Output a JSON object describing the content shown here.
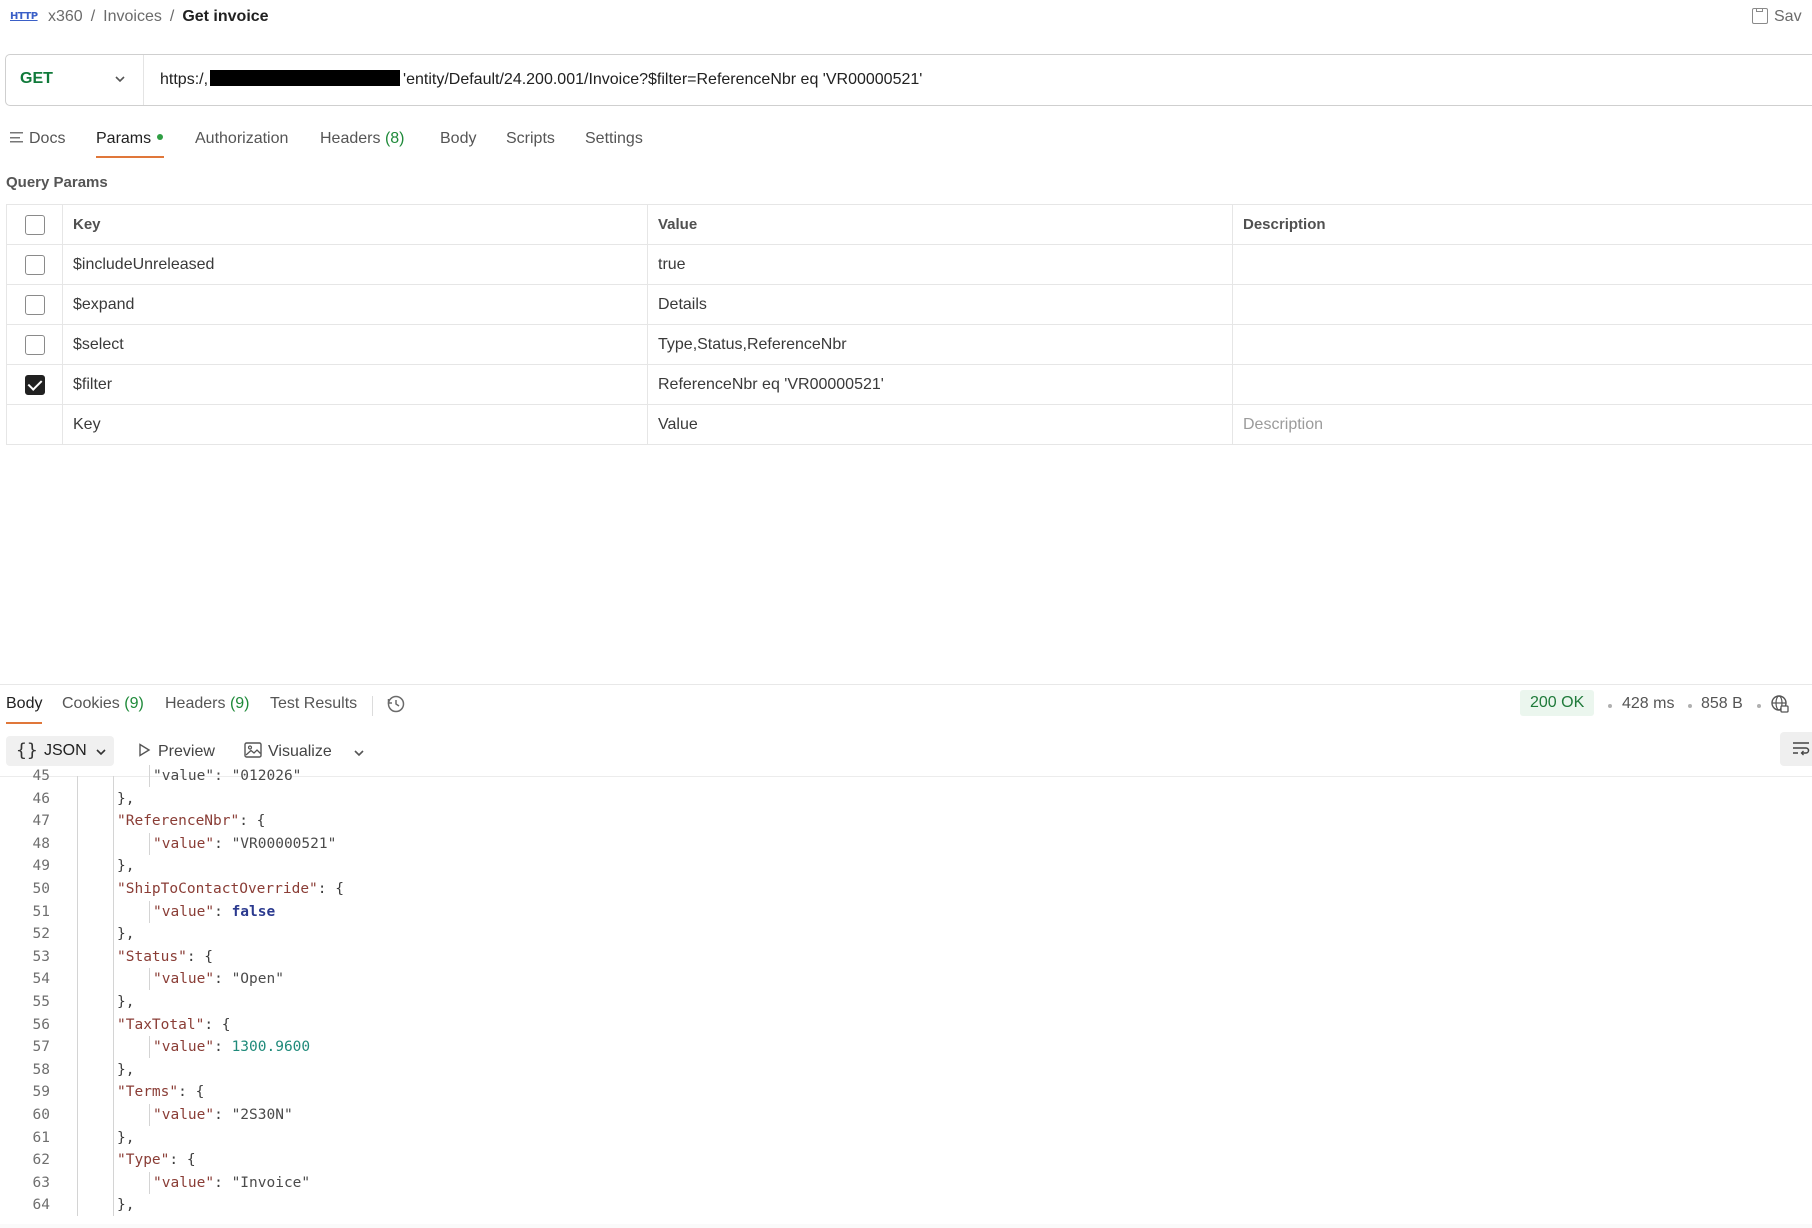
{
  "breadcrumb": {
    "icon_text": "HTTP",
    "items": [
      "x360",
      "Invoices"
    ],
    "current": "Get invoice"
  },
  "save_label": "Sav",
  "request": {
    "method": "GET",
    "url_prefix": "https:/,",
    "url_suffix": "'entity/Default/24.200.001/Invoice?$filter=ReferenceNbr eq 'VR00000521'"
  },
  "request_tabs": {
    "docs": "Docs",
    "params": "Params",
    "authorization": "Authorization",
    "headers": "Headers",
    "headers_count": "(8)",
    "body": "Body",
    "scripts": "Scripts",
    "settings": "Settings"
  },
  "query_params": {
    "title": "Query Params",
    "headers": {
      "key": "Key",
      "value": "Value",
      "description": "Description"
    },
    "rows": [
      {
        "checked": false,
        "key": "$includeUnreleased",
        "value": "true",
        "description": ""
      },
      {
        "checked": false,
        "key": "$expand",
        "value": "Details",
        "description": ""
      },
      {
        "checked": false,
        "key": "$select",
        "value": "Type,Status,ReferenceNbr",
        "description": ""
      },
      {
        "checked": true,
        "key": "$filter",
        "value": "ReferenceNbr eq 'VR00000521'",
        "description": ""
      }
    ],
    "placeholders": {
      "key": "Key",
      "value": "Value",
      "description": "Description"
    }
  },
  "response_tabs": {
    "body": "Body",
    "cookies": "Cookies",
    "cookies_count": "(9)",
    "headers": "Headers",
    "headers_count": "(9)",
    "test_results": "Test Results"
  },
  "response_meta": {
    "status": "200 OK",
    "time": "428 ms",
    "size": "858 B"
  },
  "format_bar": {
    "format": "JSON",
    "preview": "Preview",
    "visualize": "Visualize"
  },
  "code_lines": [
    {
      "n": "45",
      "indent": 2,
      "parts": [
        [
          "s",
          "\"value\": \"012026\""
        ]
      ]
    },
    {
      "n": "46",
      "indent": 1,
      "parts": [
        [
          "p",
          "},"
        ]
      ]
    },
    {
      "n": "47",
      "indent": 1,
      "parts": [
        [
          "k",
          "\"ReferenceNbr\""
        ],
        [
          "p",
          ": {"
        ]
      ]
    },
    {
      "n": "48",
      "indent": 2,
      "parts": [
        [
          "k",
          "\"value\""
        ],
        [
          "p",
          ": "
        ],
        [
          "s",
          "\"VR00000521\""
        ]
      ]
    },
    {
      "n": "49",
      "indent": 1,
      "parts": [
        [
          "p",
          "},"
        ]
      ]
    },
    {
      "n": "50",
      "indent": 1,
      "parts": [
        [
          "k",
          "\"ShipToContactOverride\""
        ],
        [
          "p",
          ": {"
        ]
      ]
    },
    {
      "n": "51",
      "indent": 2,
      "parts": [
        [
          "k",
          "\"value\""
        ],
        [
          "p",
          ": "
        ],
        [
          "kw",
          "false"
        ]
      ]
    },
    {
      "n": "52",
      "indent": 1,
      "parts": [
        [
          "p",
          "},"
        ]
      ]
    },
    {
      "n": "53",
      "indent": 1,
      "parts": [
        [
          "k",
          "\"Status\""
        ],
        [
          "p",
          ": {"
        ]
      ]
    },
    {
      "n": "54",
      "indent": 2,
      "parts": [
        [
          "k",
          "\"value\""
        ],
        [
          "p",
          ": "
        ],
        [
          "s",
          "\"Open\""
        ]
      ]
    },
    {
      "n": "55",
      "indent": 1,
      "parts": [
        [
          "p",
          "},"
        ]
      ]
    },
    {
      "n": "56",
      "indent": 1,
      "parts": [
        [
          "k",
          "\"TaxTotal\""
        ],
        [
          "p",
          ": {"
        ]
      ]
    },
    {
      "n": "57",
      "indent": 2,
      "parts": [
        [
          "k",
          "\"value\""
        ],
        [
          "p",
          ": "
        ],
        [
          "n",
          "1300.9600"
        ]
      ]
    },
    {
      "n": "58",
      "indent": 1,
      "parts": [
        [
          "p",
          "},"
        ]
      ]
    },
    {
      "n": "59",
      "indent": 1,
      "parts": [
        [
          "k",
          "\"Terms\""
        ],
        [
          "p",
          ": {"
        ]
      ]
    },
    {
      "n": "60",
      "indent": 2,
      "parts": [
        [
          "k",
          "\"value\""
        ],
        [
          "p",
          ": "
        ],
        [
          "s",
          "\"2S30N\""
        ]
      ]
    },
    {
      "n": "61",
      "indent": 1,
      "parts": [
        [
          "p",
          "},"
        ]
      ]
    },
    {
      "n": "62",
      "indent": 1,
      "parts": [
        [
          "k",
          "\"Type\""
        ],
        [
          "p",
          ": {"
        ]
      ]
    },
    {
      "n": "63",
      "indent": 2,
      "parts": [
        [
          "k",
          "\"value\""
        ],
        [
          "p",
          ": "
        ],
        [
          "s",
          "\"Invoice\""
        ]
      ]
    },
    {
      "n": "64",
      "indent": 1,
      "parts": [
        [
          "p",
          "},"
        ]
      ]
    }
  ],
  "colors": {
    "accent": "#e0773a",
    "method_get": "#107a3a",
    "status_ok_bg": "#ebf6ee",
    "status_ok_text": "#1f7a3a",
    "param_dot": "#2f9e44"
  },
  "icons": [
    "http-icon",
    "save-icon",
    "chevron-down-icon",
    "docs-icon",
    "history-icon",
    "globe-lock-icon",
    "json-braces-icon",
    "play-icon",
    "image-icon",
    "wrap-lines-icon"
  ]
}
